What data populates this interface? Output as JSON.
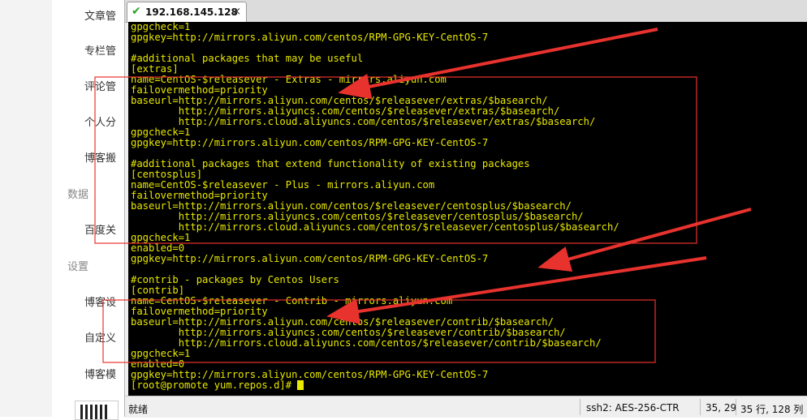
{
  "sidebar": {
    "items": [
      "文章管",
      "专栏管",
      "评论管",
      "个人分",
      "博客搬",
      "百度关",
      "博客设",
      "自定义",
      "博客模"
    ],
    "sections": [
      "数据",
      "设置"
    ]
  },
  "tab": {
    "title": "192.168.145.128",
    "close": "×"
  },
  "terminal": {
    "lines": [
      "gpgcheck=1",
      "gpgkey=http://mirrors.aliyun.com/centos/RPM-GPG-KEY-CentOS-7",
      "",
      "#additional packages that may be useful",
      "[extras]",
      "name=CentOS-$releasever - Extras - mirrors.aliyun.com",
      "failovermethod=priority",
      "baseurl=http://mirrors.aliyun.com/centos/$releasever/extras/$basearch/",
      "        http://mirrors.aliyuncs.com/centos/$releasever/extras/$basearch/",
      "        http://mirrors.cloud.aliyuncs.com/centos/$releasever/extras/$basearch/",
      "gpgcheck=1",
      "gpgkey=http://mirrors.aliyun.com/centos/RPM-GPG-KEY-CentOS-7",
      "",
      "#additional packages that extend functionality of existing packages",
      "[centosplus]",
      "name=CentOS-$releasever - Plus - mirrors.aliyun.com",
      "failovermethod=priority",
      "baseurl=http://mirrors.aliyun.com/centos/$releasever/centosplus/$basearch/",
      "        http://mirrors.aliyuncs.com/centos/$releasever/centosplus/$basearch/",
      "        http://mirrors.cloud.aliyuncs.com/centos/$releasever/centosplus/$basearch/",
      "gpgcheck=1",
      "enabled=0",
      "gpgkey=http://mirrors.aliyun.com/centos/RPM-GPG-KEY-CentOS-7",
      "",
      "#contrib - packages by Centos Users",
      "[contrib]",
      "name=CentOS-$releasever - Contrib - mirrors.aliyun.com",
      "failovermethod=priority",
      "baseurl=http://mirrors.aliyun.com/centos/$releasever/contrib/$basearch/",
      "        http://mirrors.aliyuncs.com/centos/$releasever/contrib/$basearch/",
      "        http://mirrors.cloud.aliyuncs.com/centos/$releasever/contrib/$basearch/",
      "gpgcheck=1",
      "enabled=0",
      "gpgkey=http://mirrors.aliyun.com/centos/RPM-GPG-KEY-CentOS-7"
    ],
    "prompt": "[root@promote yum.repos.d]# "
  },
  "status": {
    "ready": "就绪",
    "ssh": "ssh2: AES-256-CTR",
    "position": "35, 29",
    "size": "35 行, 128 列"
  },
  "colors": {
    "terminal_bg": "#000000",
    "terminal_fg": "#e8e800",
    "annotation": "#e8322d"
  }
}
